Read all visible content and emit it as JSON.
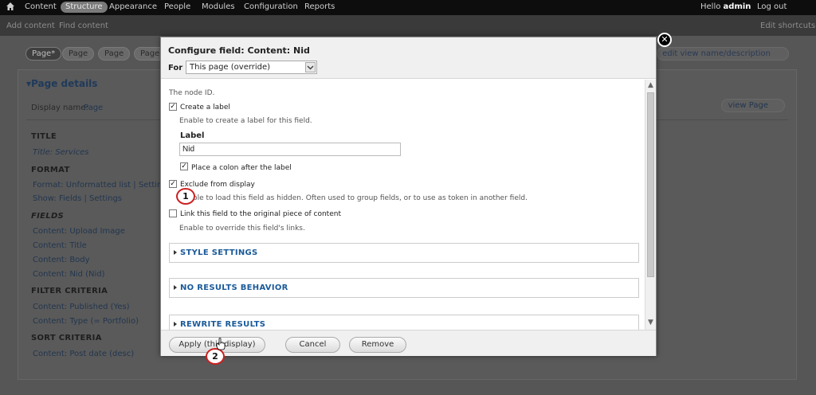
{
  "toolbar": {
    "items": [
      "Content",
      "Structure",
      "Appearance",
      "People",
      "Modules",
      "Configuration",
      "Reports"
    ],
    "hello_prefix": "Hello ",
    "user": "admin",
    "logout": "Log out"
  },
  "shortcuts": {
    "add_content": "Add content",
    "find_content": "Find content",
    "edit_shortcuts": "Edit shortcuts"
  },
  "background": {
    "tabs": [
      "Page*",
      "Page",
      "Page",
      "Page"
    ],
    "edit_view_name": "edit view name/description",
    "page_details": "Page details",
    "display_name_label": "Display name:",
    "display_name_value": "Page",
    "view_page": "view Page",
    "title_head": "TITLE",
    "title_value": "Title: Services",
    "format_head": "FORMAT",
    "format_line": "Format: Unformatted list | Settings",
    "show_line": "Show: Fields | Settings",
    "fields_head": "FIELDS",
    "fields": [
      "Content: Upload Image",
      "Content: Title",
      "Content: Body",
      "Content: Nid (Nid)"
    ],
    "filter_head": "FILTER CRITERIA",
    "filters": [
      "Content: Published (Yes)",
      "Content: Type (= Portfolio)"
    ],
    "sort_head": "SORT CRITERIA",
    "sorts": [
      "Content: Post date (desc)"
    ]
  },
  "dialog": {
    "title": "Configure field: Content: Nid",
    "for_label": "For",
    "for_value": "This page (override)",
    "description": "The node ID.",
    "create_label": {
      "label": "Create a label",
      "checked": true,
      "help": "Enable to create a label for this field."
    },
    "label_field": {
      "label": "Label",
      "value": "Nid"
    },
    "place_colon": {
      "label": "Place a colon after the label",
      "checked": true
    },
    "exclude": {
      "label": "Exclude from display",
      "checked": true,
      "help": "Enable to load this field as hidden. Often used to group fields, or to use as token in another field."
    },
    "link_field": {
      "label": "Link this field to the original piece of content",
      "checked": false,
      "help": "Enable to override this field's links."
    },
    "sections": [
      "STYLE SETTINGS",
      "NO RESULTS BEHAVIOR",
      "REWRITE RESULTS"
    ],
    "buttons": {
      "apply": "Apply (this display)",
      "cancel": "Cancel",
      "remove": "Remove"
    }
  },
  "markers": [
    "1",
    "2"
  ]
}
